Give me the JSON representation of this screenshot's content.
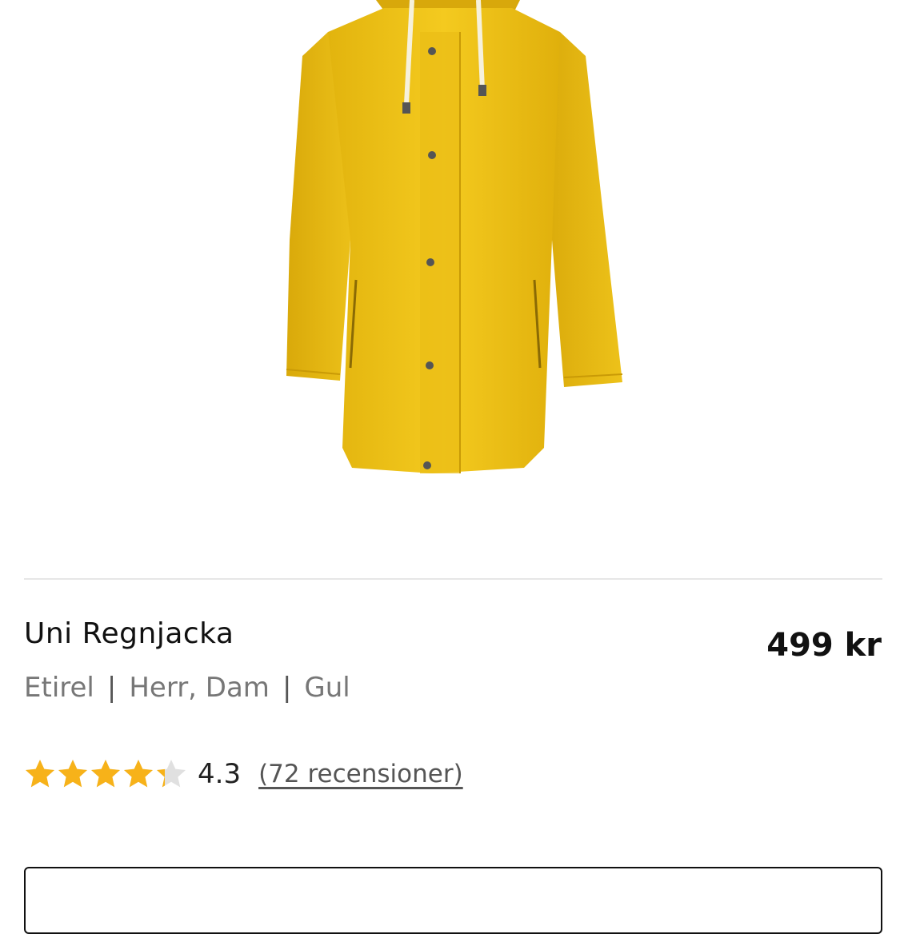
{
  "product": {
    "name": "Uni Regnjacka",
    "price": "499 kr",
    "brand": "Etirel",
    "gender": "Herr, Dam",
    "color": "Gul",
    "separator": "|",
    "rating": {
      "value": "4.3",
      "stars_fraction": 0.86,
      "reviews_label": "(72 recensioner)"
    },
    "image_icon": "yellow-raincoat-image"
  },
  "colors": {
    "star_filled": "#F7B219",
    "star_empty": "#E0E0E0",
    "coat": "#F0C419"
  }
}
